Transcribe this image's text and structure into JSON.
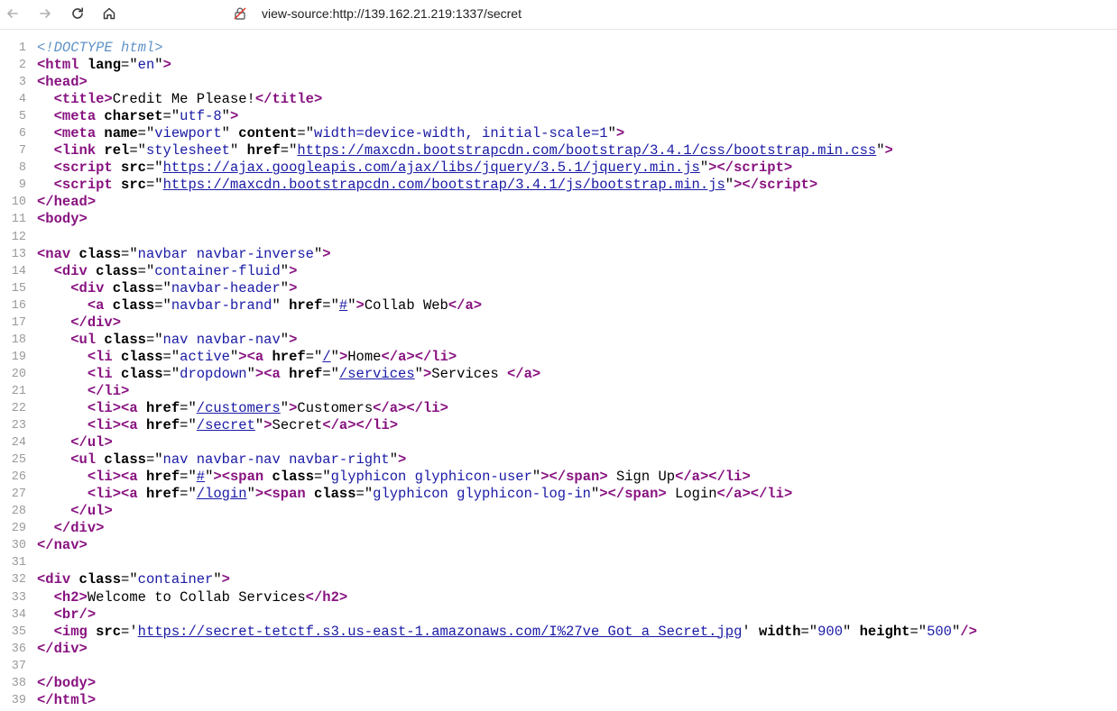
{
  "browser": {
    "address_url": "view-source:http://139.162.21.219:1337/secret"
  },
  "lines": [
    [
      [
        "doctype",
        "<!DOCTYPE html>"
      ]
    ],
    [
      [
        "tag",
        "<html"
      ],
      [
        "attr",
        " lang"
      ],
      [
        "text",
        "=\""
      ],
      [
        "val",
        "en"
      ],
      [
        "text",
        "\""
      ],
      [
        "tag",
        ">"
      ]
    ],
    [
      [
        "tag",
        "<head"
      ],
      [
        "tag",
        ">"
      ]
    ],
    [
      [
        "text",
        "  "
      ],
      [
        "tag",
        "<title"
      ],
      [
        "tag",
        ">"
      ],
      [
        "text",
        "Credit Me Please!"
      ],
      [
        "tag",
        "</title"
      ],
      [
        "tag",
        ">"
      ]
    ],
    [
      [
        "text",
        "  "
      ],
      [
        "tag",
        "<meta"
      ],
      [
        "attr",
        " charset"
      ],
      [
        "text",
        "=\""
      ],
      [
        "val",
        "utf-8"
      ],
      [
        "text",
        "\""
      ],
      [
        "tag",
        ">"
      ]
    ],
    [
      [
        "text",
        "  "
      ],
      [
        "tag",
        "<meta"
      ],
      [
        "attr",
        " name"
      ],
      [
        "text",
        "=\""
      ],
      [
        "val",
        "viewport"
      ],
      [
        "text",
        "\""
      ],
      [
        "attr",
        " content"
      ],
      [
        "text",
        "=\""
      ],
      [
        "val",
        "width=device-width, initial-scale=1"
      ],
      [
        "text",
        "\""
      ],
      [
        "tag",
        ">"
      ]
    ],
    [
      [
        "text",
        "  "
      ],
      [
        "tag",
        "<link"
      ],
      [
        "attr",
        " rel"
      ],
      [
        "text",
        "=\""
      ],
      [
        "val",
        "stylesheet"
      ],
      [
        "text",
        "\""
      ],
      [
        "attr",
        " href"
      ],
      [
        "text",
        "=\""
      ],
      [
        "link",
        "https://maxcdn.bootstrapcdn.com/bootstrap/3.4.1/css/bootstrap.min.css"
      ],
      [
        "text",
        "\""
      ],
      [
        "tag",
        ">"
      ]
    ],
    [
      [
        "text",
        "  "
      ],
      [
        "tag",
        "<script"
      ],
      [
        "attr",
        " src"
      ],
      [
        "text",
        "=\""
      ],
      [
        "link",
        "https://ajax.googleapis.com/ajax/libs/jquery/3.5.1/jquery.min.js"
      ],
      [
        "text",
        "\""
      ],
      [
        "tag",
        ">"
      ],
      [
        "tag",
        "</script"
      ],
      [
        "tag",
        ">"
      ]
    ],
    [
      [
        "text",
        "  "
      ],
      [
        "tag",
        "<script"
      ],
      [
        "attr",
        " src"
      ],
      [
        "text",
        "=\""
      ],
      [
        "link",
        "https://maxcdn.bootstrapcdn.com/bootstrap/3.4.1/js/bootstrap.min.js"
      ],
      [
        "text",
        "\""
      ],
      [
        "tag",
        ">"
      ],
      [
        "tag",
        "</script"
      ],
      [
        "tag",
        ">"
      ]
    ],
    [
      [
        "tag",
        "</head"
      ],
      [
        "tag",
        ">"
      ]
    ],
    [
      [
        "tag",
        "<body"
      ],
      [
        "tag",
        ">"
      ]
    ],
    [],
    [
      [
        "tag",
        "<nav"
      ],
      [
        "attr",
        " class"
      ],
      [
        "text",
        "=\""
      ],
      [
        "val",
        "navbar navbar-inverse"
      ],
      [
        "text",
        "\""
      ],
      [
        "tag",
        ">"
      ]
    ],
    [
      [
        "text",
        "  "
      ],
      [
        "tag",
        "<div"
      ],
      [
        "attr",
        " class"
      ],
      [
        "text",
        "=\""
      ],
      [
        "val",
        "container-fluid"
      ],
      [
        "text",
        "\""
      ],
      [
        "tag",
        ">"
      ]
    ],
    [
      [
        "text",
        "    "
      ],
      [
        "tag",
        "<div"
      ],
      [
        "attr",
        " class"
      ],
      [
        "text",
        "=\""
      ],
      [
        "val",
        "navbar-header"
      ],
      [
        "text",
        "\""
      ],
      [
        "tag",
        ">"
      ]
    ],
    [
      [
        "text",
        "      "
      ],
      [
        "tag",
        "<a"
      ],
      [
        "attr",
        " class"
      ],
      [
        "text",
        "=\""
      ],
      [
        "val",
        "navbar-brand"
      ],
      [
        "text",
        "\""
      ],
      [
        "attr",
        " href"
      ],
      [
        "text",
        "=\""
      ],
      [
        "link",
        "#"
      ],
      [
        "text",
        "\""
      ],
      [
        "tag",
        ">"
      ],
      [
        "text",
        "Collab Web"
      ],
      [
        "tag",
        "</a"
      ],
      [
        "tag",
        ">"
      ]
    ],
    [
      [
        "text",
        "    "
      ],
      [
        "tag",
        "</div"
      ],
      [
        "tag",
        ">"
      ]
    ],
    [
      [
        "text",
        "    "
      ],
      [
        "tag",
        "<ul"
      ],
      [
        "attr",
        " class"
      ],
      [
        "text",
        "=\""
      ],
      [
        "val",
        "nav navbar-nav"
      ],
      [
        "text",
        "\""
      ],
      [
        "tag",
        ">"
      ]
    ],
    [
      [
        "text",
        "      "
      ],
      [
        "tag",
        "<li"
      ],
      [
        "attr",
        " class"
      ],
      [
        "text",
        "=\""
      ],
      [
        "val",
        "active"
      ],
      [
        "text",
        "\""
      ],
      [
        "tag",
        ">"
      ],
      [
        "tag",
        "<a"
      ],
      [
        "attr",
        " href"
      ],
      [
        "text",
        "=\""
      ],
      [
        "link",
        "/"
      ],
      [
        "text",
        "\""
      ],
      [
        "tag",
        ">"
      ],
      [
        "text",
        "Home"
      ],
      [
        "tag",
        "</a"
      ],
      [
        "tag",
        ">"
      ],
      [
        "tag",
        "</li"
      ],
      [
        "tag",
        ">"
      ]
    ],
    [
      [
        "text",
        "      "
      ],
      [
        "tag",
        "<li"
      ],
      [
        "attr",
        " class"
      ],
      [
        "text",
        "=\""
      ],
      [
        "val",
        "dropdown"
      ],
      [
        "text",
        "\""
      ],
      [
        "tag",
        ">"
      ],
      [
        "tag",
        "<a"
      ],
      [
        "attr",
        " href"
      ],
      [
        "text",
        "=\""
      ],
      [
        "link",
        "/services"
      ],
      [
        "text",
        "\""
      ],
      [
        "tag",
        ">"
      ],
      [
        "text",
        "Services "
      ],
      [
        "tag",
        "</a"
      ],
      [
        "tag",
        ">"
      ]
    ],
    [
      [
        "text",
        "      "
      ],
      [
        "tag",
        "</li"
      ],
      [
        "tag",
        ">"
      ]
    ],
    [
      [
        "text",
        "      "
      ],
      [
        "tag",
        "<li"
      ],
      [
        "tag",
        ">"
      ],
      [
        "tag",
        "<a"
      ],
      [
        "attr",
        " href"
      ],
      [
        "text",
        "=\""
      ],
      [
        "link",
        "/customers"
      ],
      [
        "text",
        "\""
      ],
      [
        "tag",
        ">"
      ],
      [
        "text",
        "Customers"
      ],
      [
        "tag",
        "</a"
      ],
      [
        "tag",
        ">"
      ],
      [
        "tag",
        "</li"
      ],
      [
        "tag",
        ">"
      ]
    ],
    [
      [
        "text",
        "      "
      ],
      [
        "tag",
        "<li"
      ],
      [
        "tag",
        ">"
      ],
      [
        "tag",
        "<a"
      ],
      [
        "attr",
        " href"
      ],
      [
        "text",
        "=\""
      ],
      [
        "link",
        "/secret"
      ],
      [
        "text",
        "\""
      ],
      [
        "tag",
        ">"
      ],
      [
        "text",
        "Secret"
      ],
      [
        "tag",
        "</a"
      ],
      [
        "tag",
        ">"
      ],
      [
        "tag",
        "</li"
      ],
      [
        "tag",
        ">"
      ]
    ],
    [
      [
        "text",
        "    "
      ],
      [
        "tag",
        "</ul"
      ],
      [
        "tag",
        ">"
      ]
    ],
    [
      [
        "text",
        "    "
      ],
      [
        "tag",
        "<ul"
      ],
      [
        "attr",
        " class"
      ],
      [
        "text",
        "=\""
      ],
      [
        "val",
        "nav navbar-nav navbar-right"
      ],
      [
        "text",
        "\""
      ],
      [
        "tag",
        ">"
      ]
    ],
    [
      [
        "text",
        "      "
      ],
      [
        "tag",
        "<li"
      ],
      [
        "tag",
        ">"
      ],
      [
        "tag",
        "<a"
      ],
      [
        "attr",
        " href"
      ],
      [
        "text",
        "=\""
      ],
      [
        "link",
        "#"
      ],
      [
        "text",
        "\""
      ],
      [
        "tag",
        ">"
      ],
      [
        "tag",
        "<span"
      ],
      [
        "attr",
        " class"
      ],
      [
        "text",
        "=\""
      ],
      [
        "val",
        "glyphicon glyphicon-user"
      ],
      [
        "text",
        "\""
      ],
      [
        "tag",
        ">"
      ],
      [
        "tag",
        "</span"
      ],
      [
        "tag",
        ">"
      ],
      [
        "text",
        " Sign Up"
      ],
      [
        "tag",
        "</a"
      ],
      [
        "tag",
        ">"
      ],
      [
        "tag",
        "</li"
      ],
      [
        "tag",
        ">"
      ]
    ],
    [
      [
        "text",
        "      "
      ],
      [
        "tag",
        "<li"
      ],
      [
        "tag",
        ">"
      ],
      [
        "tag",
        "<a"
      ],
      [
        "attr",
        " href"
      ],
      [
        "text",
        "=\""
      ],
      [
        "link",
        "/login"
      ],
      [
        "text",
        "\""
      ],
      [
        "tag",
        ">"
      ],
      [
        "tag",
        "<span"
      ],
      [
        "attr",
        " class"
      ],
      [
        "text",
        "=\""
      ],
      [
        "val",
        "glyphicon glyphicon-log-in"
      ],
      [
        "text",
        "\""
      ],
      [
        "tag",
        ">"
      ],
      [
        "tag",
        "</span"
      ],
      [
        "tag",
        ">"
      ],
      [
        "text",
        " Login"
      ],
      [
        "tag",
        "</a"
      ],
      [
        "tag",
        ">"
      ],
      [
        "tag",
        "</li"
      ],
      [
        "tag",
        ">"
      ]
    ],
    [
      [
        "text",
        "    "
      ],
      [
        "tag",
        "</ul"
      ],
      [
        "tag",
        ">"
      ]
    ],
    [
      [
        "text",
        "  "
      ],
      [
        "tag",
        "</div"
      ],
      [
        "tag",
        ">"
      ]
    ],
    [
      [
        "tag",
        "</nav"
      ],
      [
        "tag",
        ">"
      ]
    ],
    [],
    [
      [
        "tag",
        "<div"
      ],
      [
        "attr",
        " class"
      ],
      [
        "text",
        "=\""
      ],
      [
        "val",
        "container"
      ],
      [
        "text",
        "\""
      ],
      [
        "tag",
        ">"
      ]
    ],
    [
      [
        "text",
        "  "
      ],
      [
        "tag",
        "<h2"
      ],
      [
        "tag",
        ">"
      ],
      [
        "text",
        "Welcome to Collab Services"
      ],
      [
        "tag",
        "</h2"
      ],
      [
        "tag",
        ">"
      ]
    ],
    [
      [
        "text",
        "  "
      ],
      [
        "tag",
        "<br"
      ],
      [
        "tag",
        "/>"
      ]
    ],
    [
      [
        "text",
        "  "
      ],
      [
        "tag",
        "<img"
      ],
      [
        "attr",
        " src"
      ],
      [
        "text",
        "='"
      ],
      [
        "link",
        "https://secret-tetctf.s3.us-east-1.amazonaws.com/I%27ve_Got_a_Secret.jpg"
      ],
      [
        "text",
        "'"
      ],
      [
        "attr",
        " width"
      ],
      [
        "text",
        "=\""
      ],
      [
        "val",
        "900"
      ],
      [
        "text",
        "\""
      ],
      [
        "attr",
        " height"
      ],
      [
        "text",
        "=\""
      ],
      [
        "val",
        "500"
      ],
      [
        "text",
        "\""
      ],
      [
        "tag",
        "/>"
      ]
    ],
    [
      [
        "tag",
        "</div"
      ],
      [
        "tag",
        ">"
      ]
    ],
    [],
    [
      [
        "tag",
        "</body"
      ],
      [
        "tag",
        ">"
      ]
    ],
    [
      [
        "tag",
        "</html"
      ],
      [
        "tag",
        ">"
      ]
    ]
  ]
}
